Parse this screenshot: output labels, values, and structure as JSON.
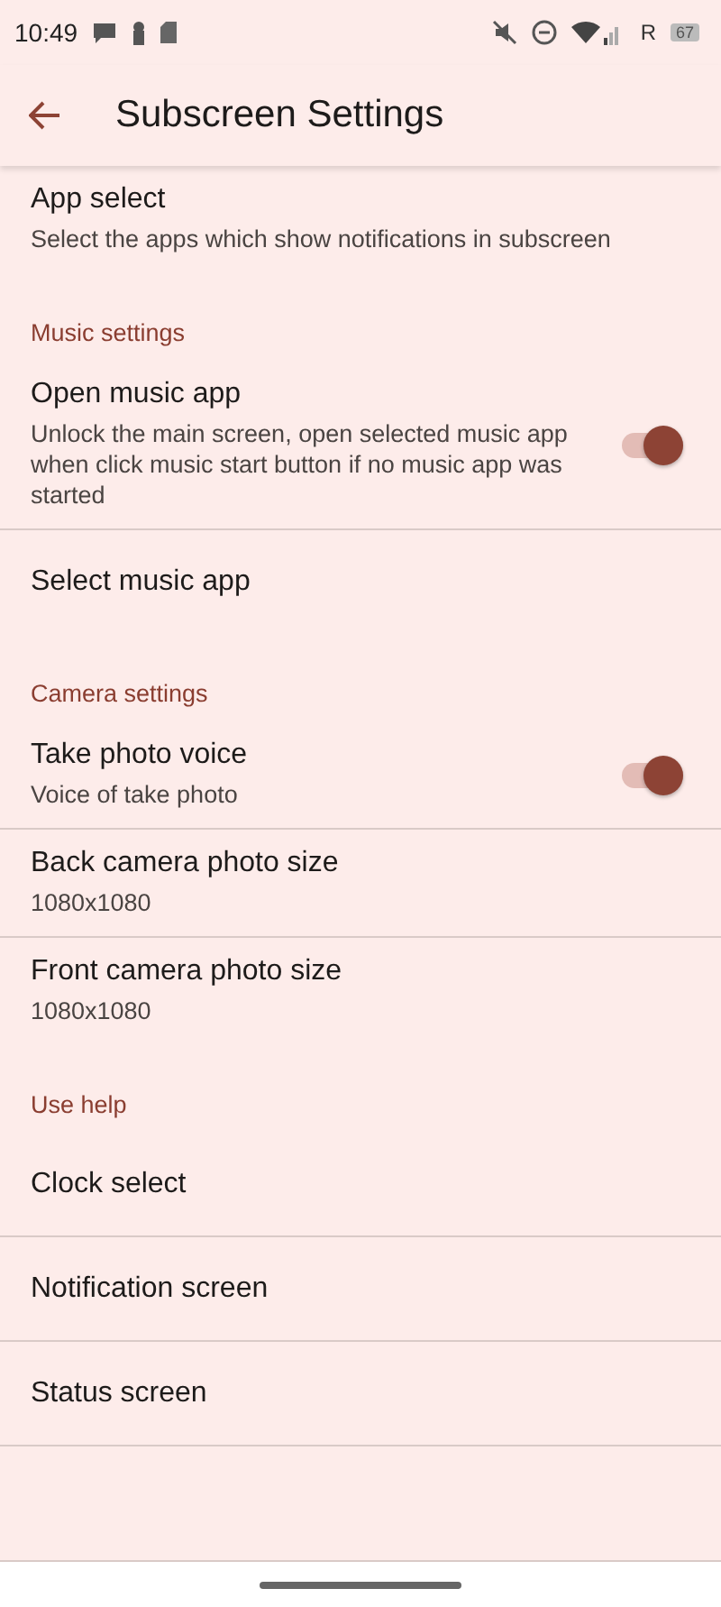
{
  "status_bar": {
    "time": "10:49",
    "roaming": "R",
    "battery": "67"
  },
  "toolbar": {
    "title": "Subscreen Settings"
  },
  "sections": [
    {
      "items": [
        {
          "kind": "plain",
          "title": "App select",
          "summary": "Select the apps which show notifications in subscreen"
        }
      ]
    },
    {
      "header": "Music settings",
      "items": [
        {
          "kind": "switch",
          "title": "Open music app",
          "summary": "Unlock the main screen, open selected music app when click music start button if no music app was started",
          "on": true
        },
        {
          "kind": "plain",
          "title": "Select music app"
        }
      ]
    },
    {
      "header": "Camera settings",
      "items": [
        {
          "kind": "switch",
          "title": "Take photo voice",
          "summary": "Voice of take photo",
          "on": true
        },
        {
          "kind": "plain",
          "title": "Back camera photo size",
          "summary": "1080x1080"
        },
        {
          "kind": "plain",
          "title": "Front camera photo size",
          "summary": "1080x1080"
        }
      ]
    },
    {
      "header": "Use help",
      "items": [
        {
          "kind": "plain",
          "title": "Clock select"
        },
        {
          "kind": "plain",
          "title": "Notification screen"
        },
        {
          "kind": "plain",
          "title": "Status screen"
        }
      ]
    }
  ]
}
